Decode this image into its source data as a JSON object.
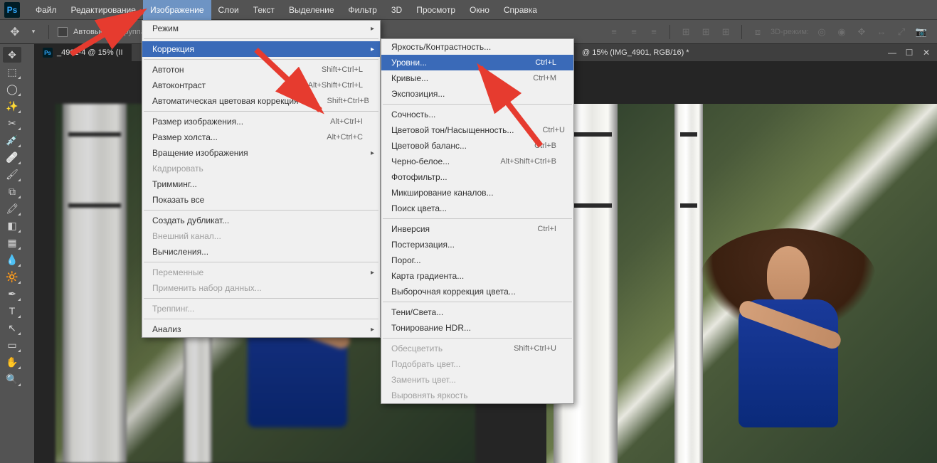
{
  "app": {
    "logo": "Ps"
  },
  "menubar": [
    "Файл",
    "Редактирование",
    "Изображение",
    "Слои",
    "Текст",
    "Выделение",
    "Фильтр",
    "3D",
    "Просмотр",
    "Окно",
    "Справка"
  ],
  "menubar_active_index": 2,
  "options": {
    "label_autoselect": "Автовыбор:",
    "dropdown_partial": "группа",
    "label_3dmode": "3D-режим:"
  },
  "tab_left": "_4901-4 @ 15% (II",
  "tab_right_title": "@ 15% (IMG_4901, RGB/16) *",
  "image_menu": [
    {
      "t": "row",
      "label": "Режим",
      "sub": true
    },
    {
      "t": "sep"
    },
    {
      "t": "row",
      "label": "Коррекция",
      "sub": true,
      "hl": true
    },
    {
      "t": "sep"
    },
    {
      "t": "row",
      "label": "Автотон",
      "sc": "Shift+Ctrl+L"
    },
    {
      "t": "row",
      "label": "Автоконтраст",
      "sc": "Alt+Shift+Ctrl+L"
    },
    {
      "t": "row",
      "label": "Автоматическая цветовая коррекция",
      "sc": "Shift+Ctrl+B"
    },
    {
      "t": "sep"
    },
    {
      "t": "row",
      "label": "Размер изображения...",
      "sc": "Alt+Ctrl+I"
    },
    {
      "t": "row",
      "label": "Размер холста...",
      "sc": "Alt+Ctrl+C"
    },
    {
      "t": "row",
      "label": "Вращение изображения",
      "sub": true
    },
    {
      "t": "row",
      "label": "Кадрировать",
      "dis": true
    },
    {
      "t": "row",
      "label": "Тримминг..."
    },
    {
      "t": "row",
      "label": "Показать все"
    },
    {
      "t": "sep"
    },
    {
      "t": "row",
      "label": "Создать дубликат..."
    },
    {
      "t": "row",
      "label": "Внешний канал...",
      "dis": true
    },
    {
      "t": "row",
      "label": "Вычисления..."
    },
    {
      "t": "sep"
    },
    {
      "t": "row",
      "label": "Переменные",
      "sub": true,
      "dis": true
    },
    {
      "t": "row",
      "label": "Применить набор данных...",
      "dis": true
    },
    {
      "t": "sep"
    },
    {
      "t": "row",
      "label": "Треппинг...",
      "dis": true
    },
    {
      "t": "sep"
    },
    {
      "t": "row",
      "label": "Анализ",
      "sub": true
    }
  ],
  "adjust_menu": [
    {
      "t": "row",
      "label": "Яркость/Контрастность..."
    },
    {
      "t": "row",
      "label": "Уровни...",
      "sc": "Ctrl+L",
      "hl": true
    },
    {
      "t": "row",
      "label": "Кривые...",
      "sc": "Ctrl+M"
    },
    {
      "t": "row",
      "label": "Экспозиция..."
    },
    {
      "t": "sep"
    },
    {
      "t": "row",
      "label": "Сочность..."
    },
    {
      "t": "row",
      "label": "Цветовой тон/Насыщенность...",
      "sc": "Ctrl+U"
    },
    {
      "t": "row",
      "label": "Цветовой баланс...",
      "sc": "Ctrl+B"
    },
    {
      "t": "row",
      "label": "Черно-белое...",
      "sc": "Alt+Shift+Ctrl+B"
    },
    {
      "t": "row",
      "label": "Фотофильтр..."
    },
    {
      "t": "row",
      "label": "Микширование каналов..."
    },
    {
      "t": "row",
      "label": "Поиск цвета..."
    },
    {
      "t": "sep"
    },
    {
      "t": "row",
      "label": "Инверсия",
      "sc": "Ctrl+I"
    },
    {
      "t": "row",
      "label": "Постеризация..."
    },
    {
      "t": "row",
      "label": "Порог..."
    },
    {
      "t": "row",
      "label": "Карта градиента..."
    },
    {
      "t": "row",
      "label": "Выборочная коррекция цвета..."
    },
    {
      "t": "sep"
    },
    {
      "t": "row",
      "label": "Тени/Света..."
    },
    {
      "t": "row",
      "label": "Тонирование HDR..."
    },
    {
      "t": "sep"
    },
    {
      "t": "row",
      "label": "Обесцветить",
      "sc": "Shift+Ctrl+U",
      "dis": true
    },
    {
      "t": "row",
      "label": "Подобрать цвет...",
      "dis": true
    },
    {
      "t": "row",
      "label": "Заменить цвет...",
      "dis": true
    },
    {
      "t": "row",
      "label": "Выровнять яркость",
      "dis": true
    }
  ],
  "tools": [
    "move",
    "marquee",
    "lasso",
    "wand",
    "crop",
    "eyedropper",
    "healing",
    "brush",
    "stamp",
    "history",
    "eraser",
    "gradient",
    "blur",
    "dodge",
    "pen",
    "type",
    "path",
    "rectangle",
    "hand",
    "zoom"
  ]
}
